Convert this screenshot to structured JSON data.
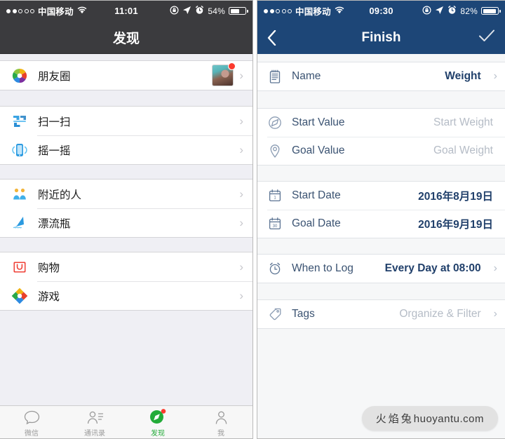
{
  "left_phone": {
    "status_bar": {
      "signal_dots_filled": 2,
      "signal_dots_total": 5,
      "carrier": "中国移动",
      "wifi_icon": "wifi-icon",
      "time": "11:01",
      "rotation_lock_icon": "rotation-lock-icon",
      "location_icon": "location-arrow-icon",
      "alarm_icon": "alarm-clock-icon",
      "battery_percent": "54%",
      "battery_level": 54
    },
    "navbar": {
      "title": "发现"
    },
    "groups": [
      {
        "rows": [
          {
            "icon": "moments-shutter-icon",
            "label": "朋友圈",
            "avatar": true,
            "badge": true,
            "chevron": "›"
          }
        ]
      },
      {
        "rows": [
          {
            "icon": "scan-qr-icon",
            "label": "扫一扫",
            "chevron": "›"
          },
          {
            "icon": "shake-icon",
            "label": "摇一摇",
            "chevron": "›"
          }
        ]
      },
      {
        "rows": [
          {
            "icon": "nearby-people-icon",
            "label": "附近的人",
            "chevron": "›"
          },
          {
            "icon": "bottle-icon",
            "label": "漂流瓶",
            "chevron": "›"
          }
        ]
      },
      {
        "rows": [
          {
            "icon": "shopping-bag-icon",
            "label": "购物",
            "chevron": "›"
          },
          {
            "icon": "games-icon",
            "label": "游戏",
            "chevron": "›"
          }
        ]
      }
    ],
    "tabbar": [
      {
        "icon": "chat-bubble-icon",
        "label": "微信",
        "active": false
      },
      {
        "icon": "contacts-icon",
        "label": "通讯录",
        "active": false
      },
      {
        "icon": "discover-compass-icon",
        "label": "发现",
        "active": true,
        "badge": true
      },
      {
        "icon": "person-icon",
        "label": "我",
        "active": false
      }
    ],
    "accent_color": "#22ab38",
    "navbar_color": "#3b3b3e"
  },
  "right_phone": {
    "status_bar": {
      "signal_dots_filled": 2,
      "signal_dots_total": 5,
      "carrier": "中国移动",
      "wifi_icon": "wifi-icon",
      "time": "09:30",
      "rotation_lock_icon": "rotation-lock-icon",
      "location_icon": "location-arrow-icon",
      "alarm_icon": "alarm-clock-icon",
      "battery_percent": "82%",
      "battery_level": 82
    },
    "navbar": {
      "back_icon": "back-chevron-icon",
      "title": "Finish",
      "confirm_icon": "checkmark-icon"
    },
    "groups": [
      {
        "rows": [
          {
            "icon": "notepad-icon",
            "label": "Name",
            "value": "Weight",
            "placeholder": false,
            "chevron": "›"
          }
        ]
      },
      {
        "rows": [
          {
            "icon": "compass-icon",
            "label": "Start Value",
            "value": "Start Weight",
            "placeholder": true,
            "chevron": ""
          },
          {
            "icon": "map-pin-icon",
            "label": "Goal Value",
            "value": "Goal Weight",
            "placeholder": true,
            "chevron": ""
          }
        ]
      },
      {
        "rows": [
          {
            "icon": "calendar-start-icon",
            "label": "Start Date",
            "value": "2016年8月19日",
            "placeholder": false,
            "chevron": ""
          },
          {
            "icon": "calendar-goal-icon",
            "label": "Goal Date",
            "value": "2016年9月19日",
            "placeholder": false,
            "chevron": ""
          }
        ]
      },
      {
        "rows": [
          {
            "icon": "alarm-clock-icon",
            "label": "When to Log",
            "value": "Every Day at 08:00",
            "placeholder": false,
            "chevron": "›"
          }
        ]
      },
      {
        "rows": [
          {
            "icon": "tag-icon",
            "label": "Tags",
            "value": "Organize & Filter",
            "placeholder": true,
            "chevron": "›"
          }
        ]
      }
    ],
    "navbar_color": "#1d4677",
    "label_color": "#3b5372",
    "value_color": "#21406b"
  },
  "watermark": {
    "cn": "火焰兔",
    "site": "huoyantu.com"
  }
}
